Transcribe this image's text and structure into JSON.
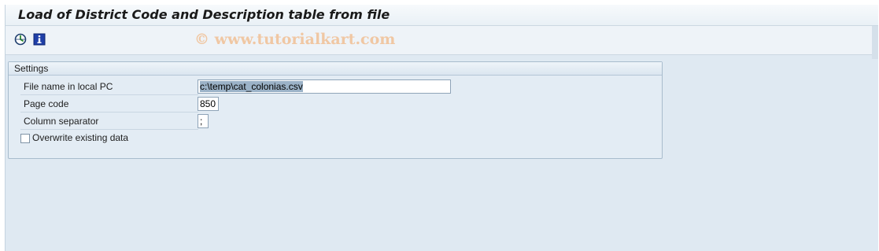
{
  "window": {
    "title": "Load of District Code and Description table from file"
  },
  "toolbar": {
    "buttons": [
      {
        "icon": "execute-icon",
        "tooltip": ""
      },
      {
        "icon": "info-icon",
        "tooltip": ""
      }
    ],
    "watermark": "© www.tutorialkart.com"
  },
  "settings": {
    "header": "Settings",
    "file_name": {
      "label": "File name in local PC",
      "value": "c:\\temp\\cat_colonias.csv"
    },
    "page_code": {
      "label": "Page code",
      "value": "850"
    },
    "column_separator": {
      "label": "Column separator",
      "value": ";"
    },
    "overwrite": {
      "label": "Overwrite existing data",
      "checked": false
    }
  },
  "colors": {
    "background": "#dfe9f2",
    "watermark": "#f0c7a3",
    "selection": "#9bb2c7",
    "info_icon": "#1f3fa8"
  }
}
